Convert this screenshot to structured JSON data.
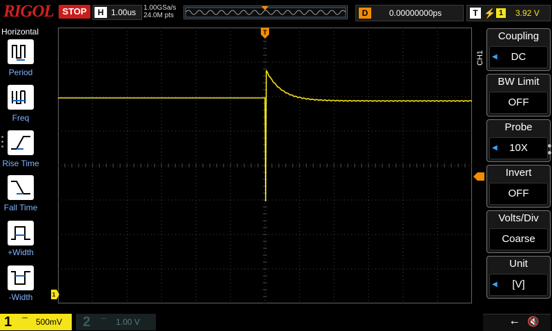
{
  "top": {
    "logo": "RIGOL",
    "run_state": "STOP",
    "horizontal": {
      "key": "H",
      "scale": "1.00us"
    },
    "sample_rate": "1.00GSa/s",
    "memory_depth": "24.0M pts",
    "delay": {
      "key": "D",
      "value": "0.00000000ps"
    },
    "trigger": {
      "key": "T",
      "edge_icon": "rising-edge-icon",
      "source": "1",
      "level": "3.92 V"
    }
  },
  "left": {
    "title": "Horizontal",
    "buttons": [
      {
        "label": "Period",
        "icon": "period-icon"
      },
      {
        "label": "Freq",
        "icon": "frequency-icon"
      },
      {
        "label": "Rise Time",
        "icon": "rise-time-icon"
      },
      {
        "label": "Fall Time",
        "icon": "fall-time-icon"
      },
      {
        "label": "+Width",
        "icon": "positive-width-icon"
      },
      {
        "label": "-Width",
        "icon": "negative-width-icon"
      }
    ]
  },
  "right": {
    "channel_tag": "CH1",
    "menus": [
      {
        "header": "Coupling",
        "value": "DC",
        "has_arrow": true
      },
      {
        "header": "BW Limit",
        "value": "OFF",
        "has_arrow": false
      },
      {
        "header": "Probe",
        "value": "10X",
        "has_arrow": true
      },
      {
        "header": "Invert",
        "value": "OFF",
        "has_arrow": false
      },
      {
        "header": "Volts/Div",
        "value": "Coarse",
        "has_arrow": false
      },
      {
        "header": "Unit",
        "value": "[V]",
        "has_arrow": true
      }
    ]
  },
  "bottom": {
    "ch1": {
      "number": "1",
      "scale": "500mV"
    },
    "ch2": {
      "number": "2",
      "scale": "1.00 V"
    },
    "status_icons": [
      "usb-icon",
      "mute-icon"
    ]
  },
  "colors": {
    "ch1": "#f5e41a",
    "accent_blue": "#3aa6ff",
    "trigger_orange": "#f08c00",
    "stop_red": "#c81e1e",
    "grid": "#4a4a4a"
  }
}
